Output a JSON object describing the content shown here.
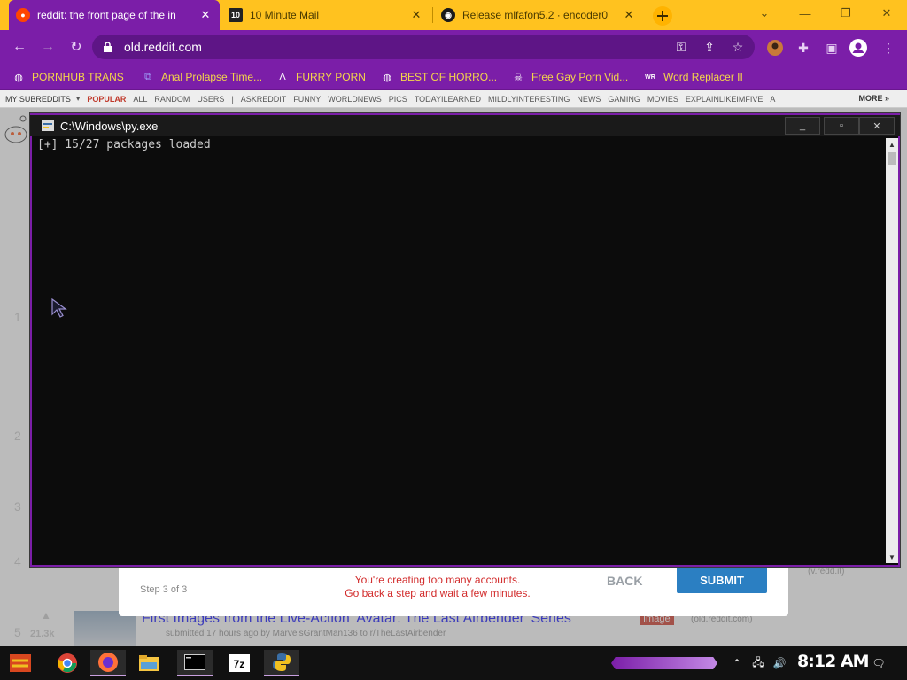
{
  "browser": {
    "tabs": [
      {
        "title": "reddit: the front page of the in",
        "active": true
      },
      {
        "title": "10 Minute Mail",
        "active": false
      },
      {
        "title": "Release mlfafon5.2 · encoder0",
        "active": false
      }
    ],
    "url": "old.reddit.com",
    "accent_color": "#7b1ea8",
    "tabstrip_color": "#ffc21f"
  },
  "bookmarks": [
    {
      "label": "PORNHUB TRANS",
      "icon": "globe-icon"
    },
    {
      "label": "Anal Prolapse Time...",
      "icon": "bracket-icon"
    },
    {
      "label": "FURRY PORN",
      "icon": "lambda-icon"
    },
    {
      "label": "BEST OF HORRO...",
      "icon": "globe-icon"
    },
    {
      "label": "Free Gay Porn Vid...",
      "icon": "skull-icon"
    },
    {
      "label": "Word Replacer II",
      "icon": "wr-icon"
    }
  ],
  "reddit": {
    "my_subreddits": "MY SUBREDDITS",
    "popular": "POPULAR",
    "subs": [
      "ALL",
      "RANDOM",
      "USERS",
      "|",
      "ASKREDDIT",
      "FUNNY",
      "WORLDNEWS",
      "PICS",
      "TODAYILEARNED",
      "MILDLYINTERESTING",
      "NEWS",
      "GAMING",
      "MOVIES",
      "EXPLAINLIKEIMFIVE",
      "A"
    ],
    "more": "MORE »",
    "ranks": [
      "1",
      "2",
      "3",
      "4"
    ],
    "post5": {
      "rank": "5",
      "score": "21.3k",
      "title": "First Images from the Live-Action 'Avatar: The Last Airbender' Series",
      "flair": "Image",
      "domain": "(old.reddit.com)",
      "tagline": "submitted 17 hours ago by MarvelsGrantMan136  to r/TheLastAirbender"
    },
    "side_domain": "(v.redd.it)"
  },
  "signup_modal": {
    "step": "Step 3 of 3",
    "error_line1": "You're creating too many accounts.",
    "error_line2": "Go back a step and wait a few minutes.",
    "back": "BACK",
    "submit": "SUBMIT"
  },
  "console": {
    "title": "C:\\Windows\\py.exe",
    "output": "[+] 15/27 packages loaded"
  },
  "taskbar": {
    "time": "8:12 AM",
    "apps": [
      "chrome-icon",
      "firefox-icon",
      "file-explorer-icon",
      "console-icon",
      "7zip-icon",
      "python-icon"
    ]
  }
}
